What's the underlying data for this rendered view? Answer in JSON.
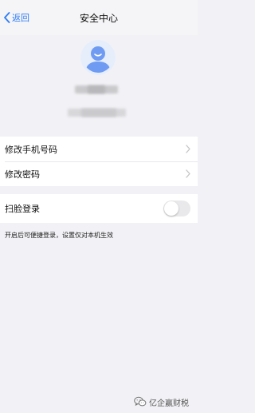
{
  "nav": {
    "back_label": "返回",
    "title": "安全中心"
  },
  "menu": {
    "items": [
      {
        "label": "修改手机号码"
      },
      {
        "label": "修改密码"
      }
    ]
  },
  "face_login": {
    "label": "扫脸登录",
    "enabled": false,
    "hint": "开启后可便捷登录，设置仅对本机生效"
  },
  "watermark": {
    "text": "亿企赢财税"
  },
  "colors": {
    "accent": "#2f7cf6",
    "background": "#f2f2f6",
    "avatar": "#6f9cf2"
  },
  "icons": [
    "chevron-left-icon",
    "avatar-icon",
    "chevron-right-icon",
    "wechat-icon"
  ]
}
